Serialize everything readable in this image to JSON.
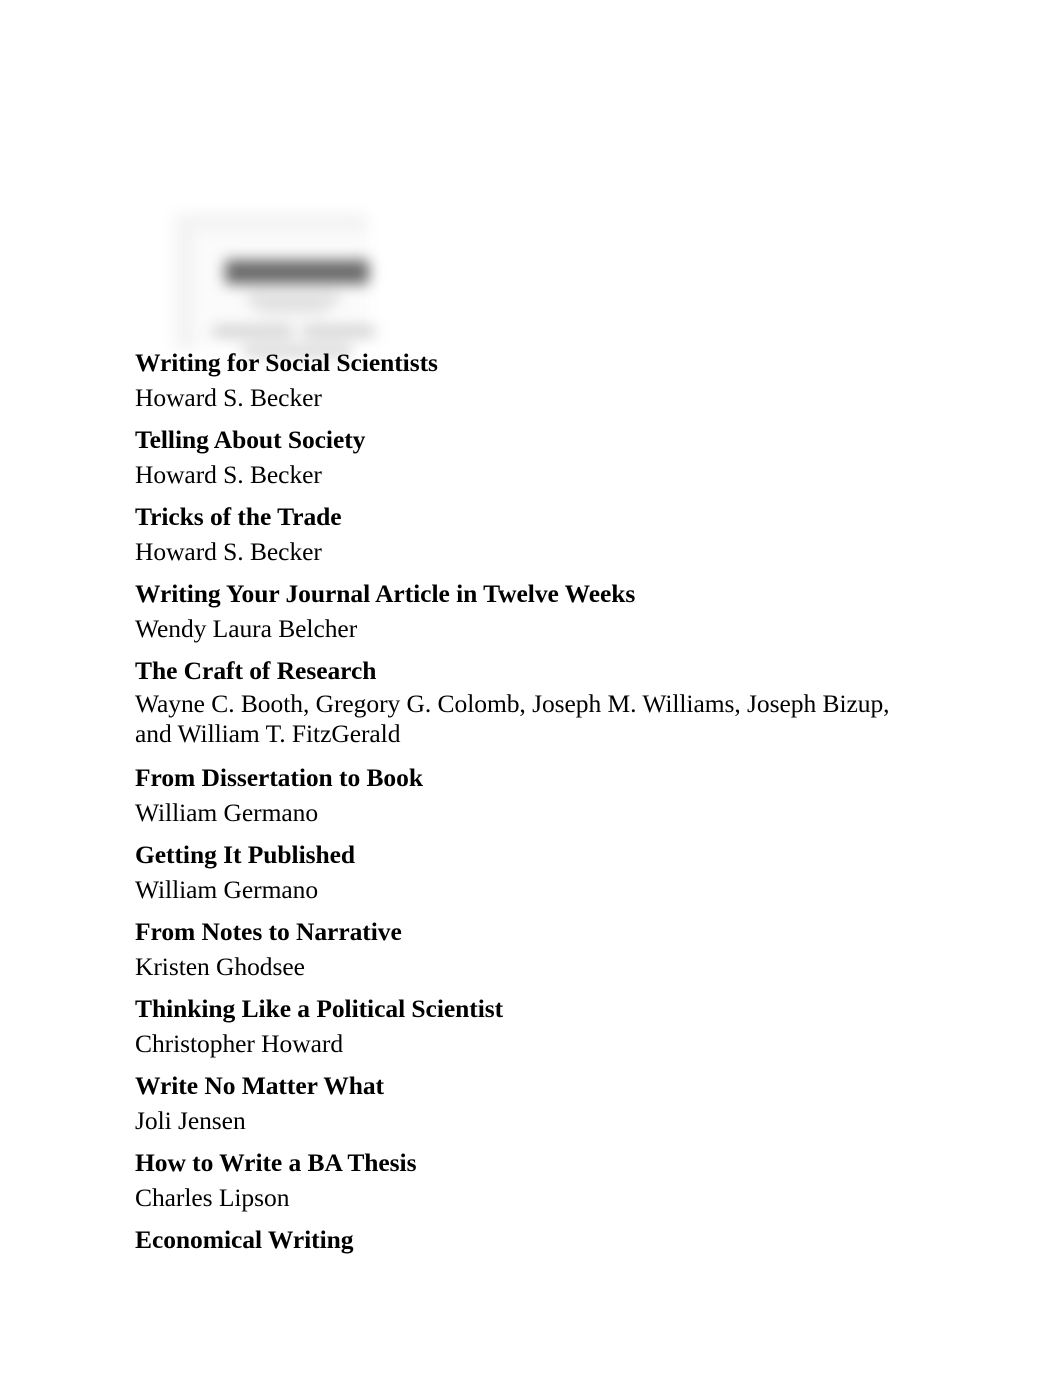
{
  "document": {
    "type": "book-series-listing",
    "background_color": "#ffffff",
    "text_color": "#000000"
  },
  "cover_image": {
    "alt": "blurred book cover thumbnail",
    "state": "blurred",
    "plate_color": "#f4f4f4",
    "band_dark_color": "#6a6a6a",
    "band_light_color": "#d2d2d2"
  },
  "books": [
    {
      "title": "Writing for Social Scientists",
      "author": "Howard S. Becker",
      "wraps": false
    },
    {
      "title": "Telling About Society",
      "author": "Howard S. Becker",
      "wraps": false
    },
    {
      "title": "Tricks of the Trade",
      "author": "Howard S. Becker",
      "wraps": false
    },
    {
      "title": "Writing Your Journal Article in Twelve Weeks",
      "author": "Wendy Laura Belcher",
      "wraps": false
    },
    {
      "title": "The Craft of Research",
      "author": "Wayne C. Booth, Gregory G. Colomb, Joseph M. Williams, Joseph Bizup, and William T. FitzGerald",
      "wraps": true
    },
    {
      "title": "From Dissertation to Book",
      "author": "William Germano",
      "wraps": false
    },
    {
      "title": "Getting It Published",
      "author": "William Germano",
      "wraps": false
    },
    {
      "title": "From Notes to Narrative",
      "author": "Kristen Ghodsee",
      "wraps": false
    },
    {
      "title": "Thinking Like a Political Scientist",
      "author": "Christopher Howard",
      "wraps": false
    },
    {
      "title": "Write No Matter What",
      "author": "Joli Jensen",
      "wraps": false
    },
    {
      "title": "How to Write a BA Thesis",
      "author": "Charles Lipson",
      "wraps": false
    },
    {
      "title": "Economical Writing",
      "author": "",
      "wraps": false
    }
  ]
}
